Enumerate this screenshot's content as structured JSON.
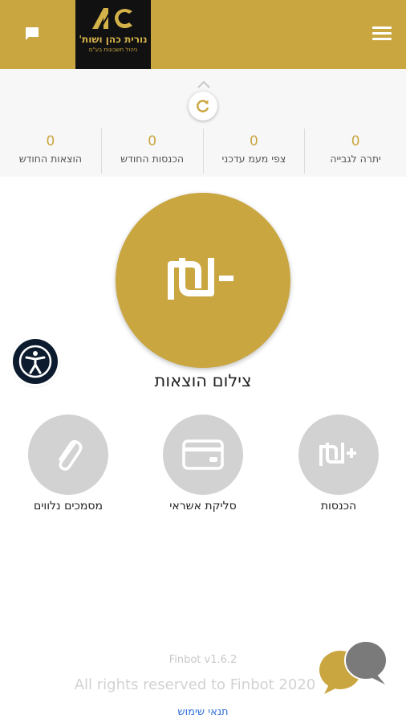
{
  "header": {
    "background": "#c9a640",
    "logo": {
      "monogram": "NC",
      "line1": "נורית כהן ושות'",
      "line2": "ניהול חשבונות בע\"מ"
    }
  },
  "stats": [
    {
      "label": "יתרה לגבייה",
      "value": "0"
    },
    {
      "label": "צפי מעמ עדכני",
      "value": "0"
    },
    {
      "label": "הכנסות החודש",
      "value": "0"
    },
    {
      "label": "הוצאות החודש",
      "value": "0"
    }
  ],
  "main_action": {
    "label": "צילום הוצאות",
    "icon": "minus-shekel-icon"
  },
  "actions": [
    {
      "label": "הכנסות",
      "icon": "plus-shekel-icon"
    },
    {
      "label": "סליקת אשראי",
      "icon": "credit-card-icon"
    },
    {
      "label": "מסמכים נלווים",
      "icon": "paperclip-icon"
    }
  ],
  "footer": {
    "version": "Finbot v1.6.2",
    "rights": "All rights reserved to Finbot 2020",
    "terms": "תנאי שימוש"
  },
  "colors": {
    "accent": "#c9a640",
    "neutral_circle": "#d2d2d2",
    "link": "#2f6fd6",
    "accessibility": "#0d1b2e"
  }
}
